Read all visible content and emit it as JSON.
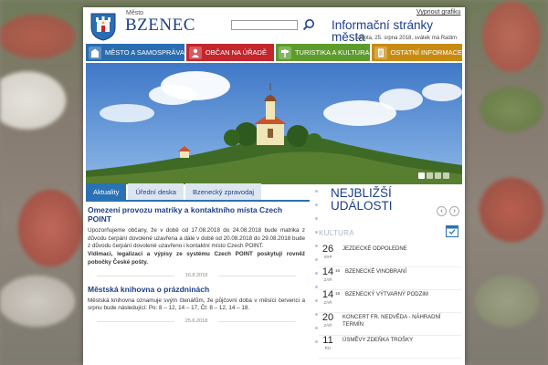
{
  "header": {
    "brand_small": "Město",
    "brand_name": "BZENEC",
    "search_placeholder": "",
    "escape_link": "Vypnout grafiku",
    "info_title": "Informační stránky města",
    "date_line": "sobota, 25. srpna 2018, svátek má Radim"
  },
  "nav": [
    {
      "label": "MĚSTO A SAMOSPRÁVA",
      "color": "#2a6db0",
      "icon": "building-icon"
    },
    {
      "label": "OBČAN NA ÚŘADĚ",
      "color": "#c3262c",
      "icon": "person-icon"
    },
    {
      "label": "TURISTIKA A KULTURA",
      "color": "#5e9b2d",
      "icon": "signpost-icon"
    },
    {
      "label": "OSTATNÍ INFORMACE",
      "color": "#c88b12",
      "icon": "document-icon"
    }
  ],
  "tabs": [
    "Aktuality",
    "Úřední deska",
    "Bzenecký zpravodaj"
  ],
  "news": [
    {
      "title": "Omezení provozu matriky a kontaktního místa Czech POINT",
      "body": "Upozorňujeme občany, že v době od 17.08.2018 do 24.08.2018 bude matrika z důvodu čerpání dovolené uzavřena a dále v době od 20.08.2018 do 29.08.2018 bude z důvodu čerpání dovolené uzavřeno i kontaktní místo Czech POINT.",
      "body_bold": "Vidimaci, legalizaci a výpisy ze systému Czech POINT poskytují rovněž pobočky České pošty.",
      "date": "16.8.2018"
    },
    {
      "title": "Městská knihovna o prázdninách",
      "body": "Městská knihovna oznamuje svým čtenářům, že půjčovní doba v měsíci červenci a srpnu bude následující: Po: 8 – 12, 14 – 17, Čt: 8 – 12, 14 – 18.",
      "date": "25.6.2018"
    }
  ],
  "events": {
    "title": "NEJBLIŽŠÍ UDÁLOSTI",
    "prev": "‹",
    "next": "›",
    "category": "KULTURA",
    "items": [
      {
        "day": "26",
        "month": "SRP",
        "time": "",
        "title": "JEZDECKÉ ODPOLEDNE"
      },
      {
        "day": "14",
        "month": "ZÁŘ",
        "time": "16",
        "title": "BZENECKÉ VINOBRANÍ"
      },
      {
        "day": "14",
        "month": "ZÁŘ",
        "time": "16",
        "title": "BZENECKÝ VÝTVARNÝ PODZIM"
      },
      {
        "day": "20",
        "month": "ZÁŘ",
        "time": "",
        "title": "KONCERT FR. NEDVĚDA - NÁHRADNÍ TERMÍN"
      },
      {
        "day": "11",
        "month": "ŘÍJ",
        "time": "",
        "title": "ÚSMĚVY ZDEŇKA TROŠKY"
      }
    ]
  },
  "colors": {
    "brand_blue": "#1d3f88",
    "tab_blue": "#2a72b3"
  }
}
